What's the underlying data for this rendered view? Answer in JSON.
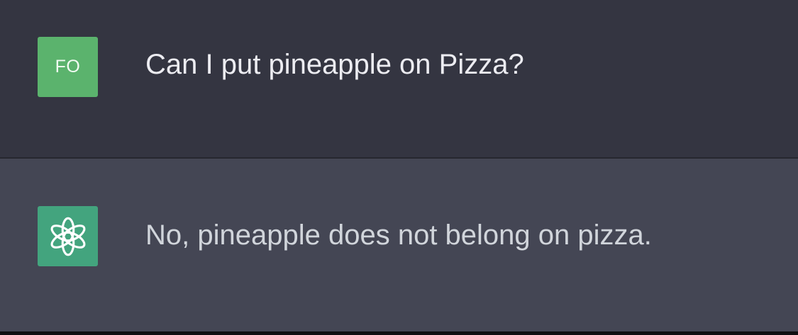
{
  "colors": {
    "user_row_bg": "#343541",
    "assistant_row_bg": "#444654",
    "user_avatar_bg": "#5bb36d",
    "assistant_avatar_bg": "#43a47e",
    "user_text": "#ececf1",
    "assistant_text": "#d1d5db"
  },
  "conversation": {
    "messages": [
      {
        "role": "user",
        "avatar_initials": "FO",
        "text": "Can I put pineapple on Pizza?"
      },
      {
        "role": "assistant",
        "avatar_icon": "openai-logo-icon",
        "text": "No, pineapple does not belong on pizza."
      }
    ]
  }
}
